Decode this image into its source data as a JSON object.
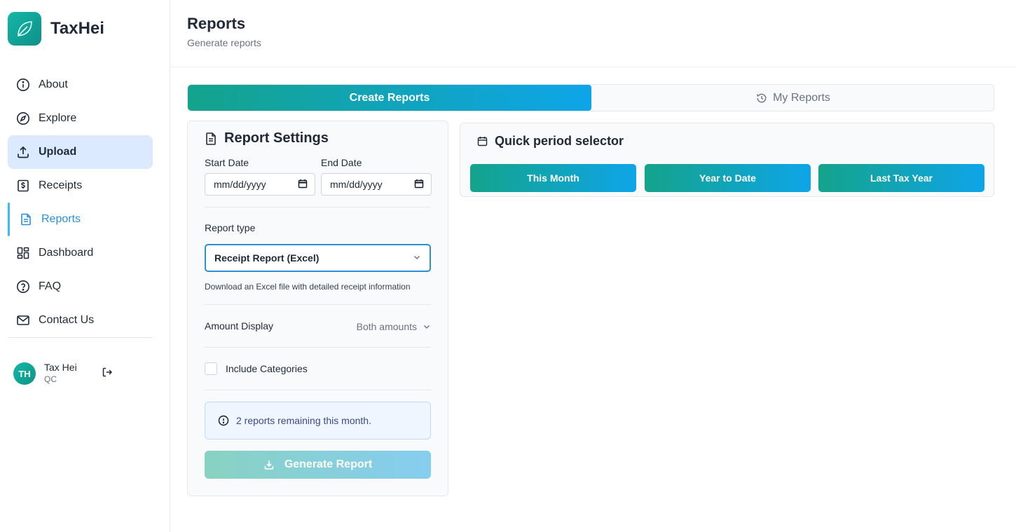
{
  "app": {
    "name": "TaxHei",
    "logo_icon": "leaf-icon"
  },
  "sidebar": {
    "items": [
      {
        "label": "About",
        "icon": "info-icon"
      },
      {
        "label": "Explore",
        "icon": "compass-icon"
      },
      {
        "label": "Upload",
        "icon": "upload-icon"
      },
      {
        "label": "Receipts",
        "icon": "receipt-icon"
      },
      {
        "label": "Reports",
        "icon": "document-icon"
      },
      {
        "label": "Dashboard",
        "icon": "grid-icon"
      },
      {
        "label": "FAQ",
        "icon": "question-icon"
      },
      {
        "label": "Contact Us",
        "icon": "mail-icon"
      }
    ],
    "user": {
      "initials": "TH",
      "name": "Tax Hei",
      "sub": "QC"
    }
  },
  "header": {
    "title": "Reports",
    "subtitle": "Generate reports"
  },
  "tabs": {
    "create": "Create Reports",
    "my": "My Reports"
  },
  "settings": {
    "title": "Report Settings",
    "start_label": "Start Date",
    "end_label": "End Date",
    "start_value": "mm/dd/yyyy",
    "end_value": "mm/dd/yyyy",
    "report_type_label": "Report type",
    "report_type_value": "Receipt Report (Excel)",
    "report_type_help": "Download an Excel file with detailed receipt information",
    "amount_label": "Amount Display",
    "amount_value": "Both amounts",
    "include_categories": "Include Categories",
    "include_categories_checked": false,
    "remaining": "2 reports remaining this month.",
    "generate": "Generate Report"
  },
  "quick": {
    "title": "Quick period selector",
    "buttons": [
      "This Month",
      "Year to Date",
      "Last Tax Year"
    ]
  },
  "colors": {
    "accent_teal": "#14a38b",
    "accent_blue": "#0ea5e9",
    "active_link": "#2b8fd6",
    "upload_active_bg": "#dbeafe"
  }
}
